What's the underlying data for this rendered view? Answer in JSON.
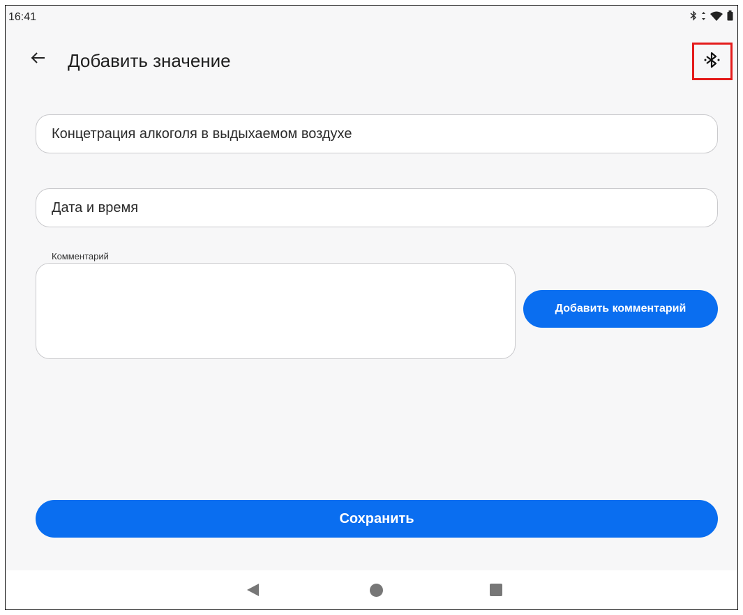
{
  "status_bar": {
    "time": "16:41",
    "icons": [
      "bluetooth-icon",
      "data-arrows-icon",
      "wifi-icon",
      "battery-icon"
    ]
  },
  "app_bar": {
    "title": "Добавить значение",
    "back_icon": "arrow-left-icon",
    "action_icon": "bluetooth-searching-icon"
  },
  "form": {
    "measurement_field": "Концетрация алкоголя в выдыхаемом воздухе",
    "datetime_field": "Дата и время",
    "comment_label": "Комментарий",
    "comment_value": "",
    "add_comment_button": "Добавить комментарий",
    "save_button": "Сохранить"
  },
  "nav_bar": {
    "icons": [
      "nav-back-icon",
      "nav-home-icon",
      "nav-recents-icon"
    ]
  },
  "colors": {
    "accent": "#0a6ef0",
    "highlight": "#e41b1b",
    "background": "#f7f7f8"
  }
}
